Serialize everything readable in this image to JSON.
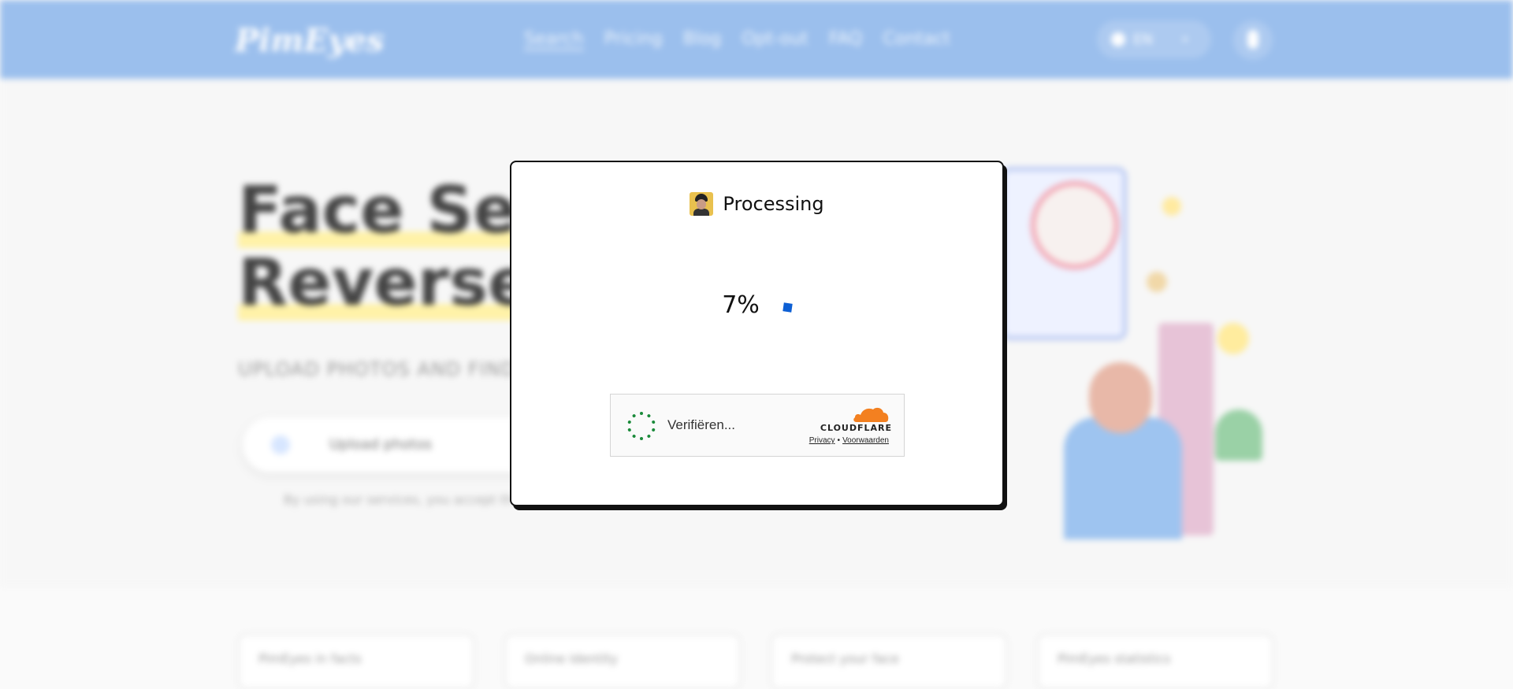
{
  "background": {
    "logo": "PimEyes",
    "nav": [
      "Search",
      "Pricing",
      "Blog",
      "Opt-out",
      "FAQ",
      "Contact"
    ],
    "language": "EN",
    "hero_title_line1": "Face Search",
    "hero_title_line2": "Reverse Image",
    "hero_subtitle": "UPLOAD PHOTOS AND FIND",
    "search_placeholder": "Upload photos",
    "hint": "By using our services, you accept the Terms",
    "cards": [
      "PimEyes in facts",
      "Online Identity",
      "Protect your face",
      "PimEyes statistics"
    ]
  },
  "modal": {
    "title": "Processing",
    "progress_percent": "7%",
    "progress_value": 0.07,
    "loader_color": "#0d5fd4"
  },
  "turnstile": {
    "status": "Verifiëren...",
    "brand": "CLOUDFLARE",
    "privacy_link": "Privacy",
    "separator": "•",
    "terms_link": "Voorwaarden",
    "spinner_color": "#1a8a3a",
    "cloud_color": "#f38020"
  }
}
